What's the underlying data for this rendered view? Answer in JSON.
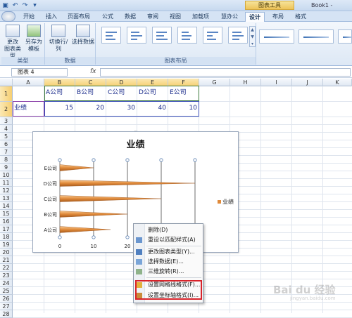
{
  "title_bar": {
    "chart_tools": "图表工具",
    "doc_title": "Book1 -"
  },
  "tabs": [
    {
      "label": "开始"
    },
    {
      "label": "插入"
    },
    {
      "label": "页面布局"
    },
    {
      "label": "公式"
    },
    {
      "label": "数据"
    },
    {
      "label": "审阅"
    },
    {
      "label": "视图"
    },
    {
      "label": "加载项"
    },
    {
      "label": "慧办公"
    },
    {
      "label": "设计"
    },
    {
      "label": "布局"
    },
    {
      "label": "格式"
    }
  ],
  "ribbon": {
    "groups": {
      "type": "类型",
      "data": "数据",
      "layout": "图表布局"
    },
    "buttons": {
      "change_chart_type": "更改\n图表类型",
      "save_as_template": "另存为\n模板",
      "switch_row_col": "切换行/列",
      "select_data": "选择数据"
    }
  },
  "formula_bar": {
    "name_box": "图表 4",
    "fx": "fx"
  },
  "columns": [
    "A",
    "B",
    "C",
    "D",
    "E",
    "F",
    "G",
    "H",
    "I",
    "J",
    "K"
  ],
  "rows": [
    "1",
    "2",
    "3",
    "4",
    "5",
    "6",
    "7",
    "8",
    "9",
    "10",
    "11",
    "12",
    "13",
    "14",
    "15",
    "16",
    "17",
    "18",
    "19",
    "20",
    "21",
    "22",
    "23",
    "24",
    "25",
    "26",
    "27",
    "28"
  ],
  "sheet": {
    "header_row": [
      "A公司",
      "B公司",
      "C公司",
      "D公司",
      "E公司"
    ],
    "label": "业绩",
    "values": [
      "15",
      "20",
      "30",
      "40",
      "10"
    ]
  },
  "chart_data": {
    "type": "bar",
    "title": "业绩",
    "categories": [
      "A公司",
      "B公司",
      "C公司",
      "D公司",
      "E公司"
    ],
    "series": [
      {
        "name": "业绩",
        "values": [
          15,
          20,
          30,
          40,
          10
        ]
      }
    ],
    "xlim": [
      0,
      40
    ],
    "x_ticks": [
      "0",
      "10",
      "20"
    ],
    "grid": true,
    "legend": "right",
    "bar_color": "#e08a3a"
  },
  "context_menu": {
    "items": [
      {
        "label": "删除(D)"
      },
      {
        "label": "重设以匹配样式(A)"
      },
      {
        "label": "更改图表类型(Y)..."
      },
      {
        "label": "选择数据(E)..."
      },
      {
        "label": "三维旋转(R)..."
      },
      {
        "label": "设置网格线格式(F)..."
      },
      {
        "label": "设置坐标轴格式(I)..."
      }
    ]
  },
  "watermark": {
    "main": "Bai du 经验",
    "sub": "jingyan.baidu.com"
  }
}
